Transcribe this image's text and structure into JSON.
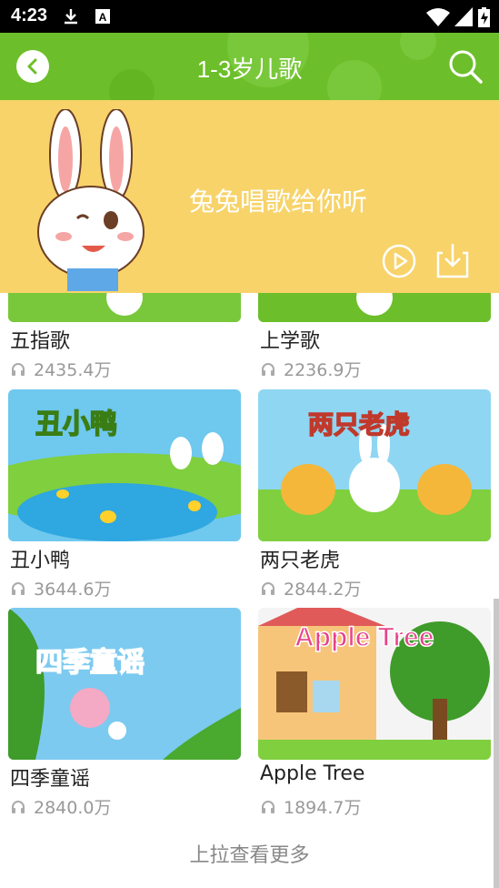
{
  "status_bar": {
    "time": "4:23"
  },
  "header": {
    "title": "1-3岁儿歌"
  },
  "banner": {
    "text": "兔兔唱歌给你听"
  },
  "songs": [
    {
      "title": "五指歌",
      "plays": "2435.4万"
    },
    {
      "title": "上学歌",
      "plays": "2236.9万"
    },
    {
      "title": "丑小鸭",
      "plays": "3644.6万",
      "thumb_text": "丑小鸭"
    },
    {
      "title": "两只老虎",
      "plays": "2844.2万",
      "thumb_text": "两只老虎"
    },
    {
      "title": "四季童谣",
      "plays": "2840.0万",
      "thumb_text": "四季童谣"
    },
    {
      "title": "Apple Tree",
      "plays": "1894.7万",
      "thumb_text": "Apple Tree"
    }
  ],
  "footer": {
    "more_label": "上拉查看更多"
  },
  "colors": {
    "header_green": "#6cbf2a",
    "banner_yellow": "#f7d36a"
  }
}
